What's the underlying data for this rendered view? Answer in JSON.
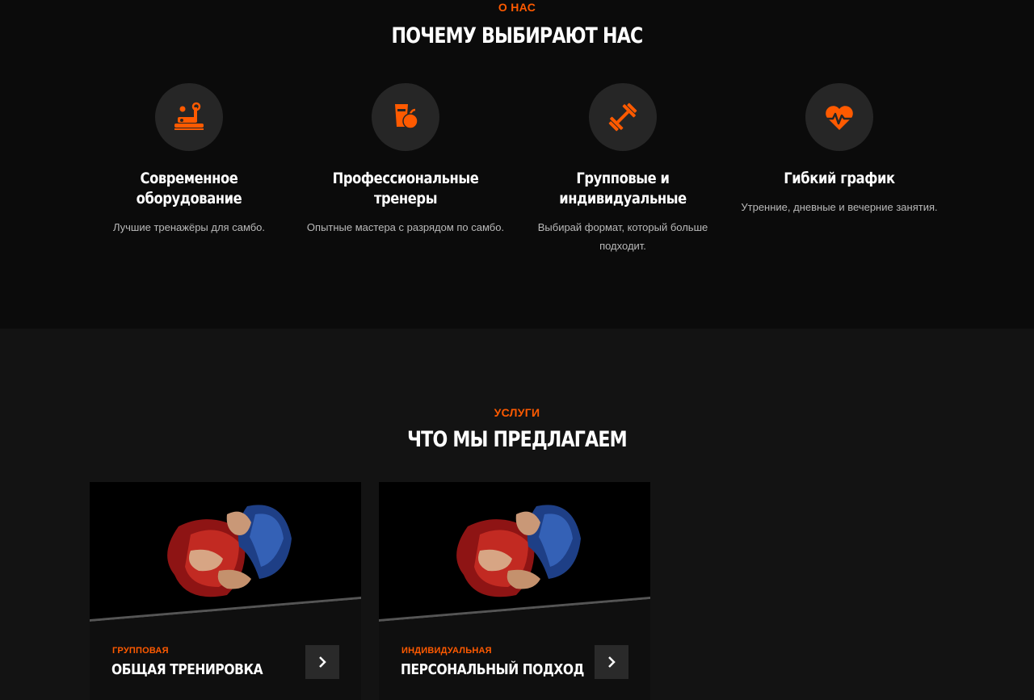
{
  "about": {
    "eyebrow": "О НАС",
    "title": "ПОЧЕМУ ВЫБИРАЮТ НАС",
    "features": [
      {
        "icon": "treadmill-icon",
        "title": "Современное оборудование",
        "desc": "Лучшие тренажёры для самбо."
      },
      {
        "icon": "nutrition-icon",
        "title": "Профессиональные тренеры",
        "desc": "Опытные мастера с разрядом по самбо."
      },
      {
        "icon": "dumbbell-icon",
        "title": "Групповые и индивидуальные",
        "desc": "Выбирай формат, который больше подходит."
      },
      {
        "icon": "heartbeat-icon",
        "title": "Гибкий график",
        "desc": "Утренние, дневные и вечерние занятия."
      }
    ]
  },
  "services": {
    "eyebrow": "УСЛУГИ",
    "title": "ЧТО МЫ ПРЕДЛАГАЕМ",
    "cards": [
      {
        "tag": "ГРУППОВАЯ",
        "name": "ОБЩАЯ ТРЕНИРОВКА",
        "image": "sambo-grip-photo",
        "action_icon": "chevron-right-icon"
      },
      {
        "tag": "ИНДИВИДУАЛЬНАЯ",
        "name": "ПЕРСОНАЛЬНЫЙ ПОДХОД",
        "image": "sambo-grip-photo",
        "action_icon": "chevron-right-icon"
      }
    ]
  },
  "colors": {
    "accent": "#ff5a00",
    "background_dark": "#0b0b0b",
    "background_section": "#131313",
    "icon_circle": "#262626",
    "muted_text": "#b9b9b9"
  }
}
